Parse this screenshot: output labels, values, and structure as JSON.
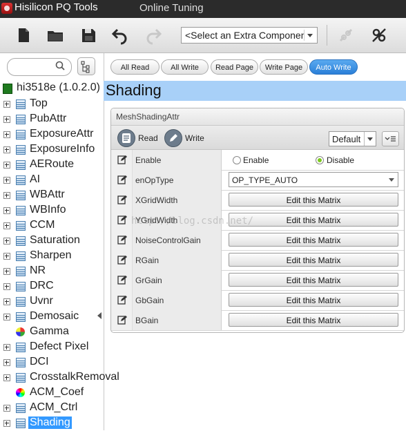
{
  "app": {
    "title": "Hisilicon PQ Tools",
    "menu_online": "Online Tuning"
  },
  "toolbar": {
    "icons": [
      "new-file-icon",
      "open-folder-icon",
      "save-icon",
      "undo-icon",
      "redo-icon",
      "disconnect-icon",
      "connect-icon"
    ],
    "extra_component_value": "<Select an Extra Component>"
  },
  "sidebar": {
    "search_placeholder": "",
    "root_label": "hi3518e (1.0.2.0)",
    "items": [
      {
        "label": "Top",
        "icon": "table-icon"
      },
      {
        "label": "PubAttr",
        "icon": "table-icon"
      },
      {
        "label": "ExposureAttr",
        "icon": "table-icon"
      },
      {
        "label": "ExposureInfo",
        "icon": "table-icon"
      },
      {
        "label": "AERoute",
        "icon": "table-icon"
      },
      {
        "label": "AI",
        "icon": "table-icon"
      },
      {
        "label": "WBAttr",
        "icon": "table-icon"
      },
      {
        "label": "WBInfo",
        "icon": "table-icon"
      },
      {
        "label": "CCM",
        "icon": "table-icon"
      },
      {
        "label": "Saturation",
        "icon": "table-icon"
      },
      {
        "label": "Sharpen",
        "icon": "table-icon"
      },
      {
        "label": "NR",
        "icon": "table-icon"
      },
      {
        "label": "DRC",
        "icon": "table-icon"
      },
      {
        "label": "Uvnr",
        "icon": "table-icon"
      },
      {
        "label": "Demosaic",
        "icon": "table-icon"
      },
      {
        "label": "Gamma",
        "icon": "gamma-icon"
      },
      {
        "label": "Defect Pixel",
        "icon": "table-icon"
      },
      {
        "label": "DCI",
        "icon": "table-icon"
      },
      {
        "label": "CrosstalkRemoval",
        "icon": "table-icon"
      },
      {
        "label": "ACM_Coef",
        "icon": "acm-icon"
      },
      {
        "label": "ACM_Ctrl",
        "icon": "table-icon"
      },
      {
        "label": "Shading",
        "icon": "table-icon",
        "selected": true
      }
    ]
  },
  "actions": {
    "all_read": "All Read",
    "all_write": "All Write",
    "read_page": "Read Page",
    "write_page": "Write Page",
    "auto_write": "Auto Write"
  },
  "page": {
    "title": "Shading"
  },
  "panel": {
    "title": "MeshShadingAttr",
    "read": "Read",
    "write": "Write",
    "preset": "Default",
    "rows": [
      {
        "name": "Enable",
        "type": "radio",
        "options": [
          "Enable",
          "Disable"
        ],
        "selected": "Disable"
      },
      {
        "name": "enOpType",
        "type": "select",
        "value": "OP_TYPE_AUTO"
      },
      {
        "name": "XGridWidth",
        "type": "matrix",
        "button": "Edit this Matrix"
      },
      {
        "name": "YGridWidth",
        "type": "matrix",
        "button": "Edit this Matrix"
      },
      {
        "name": "NoiseControlGain",
        "type": "matrix",
        "button": "Edit this Matrix"
      },
      {
        "name": "RGain",
        "type": "matrix",
        "button": "Edit this Matrix"
      },
      {
        "name": "GrGain",
        "type": "matrix",
        "button": "Edit this Matrix"
      },
      {
        "name": "GbGain",
        "type": "matrix",
        "button": "Edit this Matrix"
      },
      {
        "name": "BGain",
        "type": "matrix",
        "button": "Edit this Matrix"
      }
    ]
  },
  "watermark": "http://blog.csdn.net/"
}
